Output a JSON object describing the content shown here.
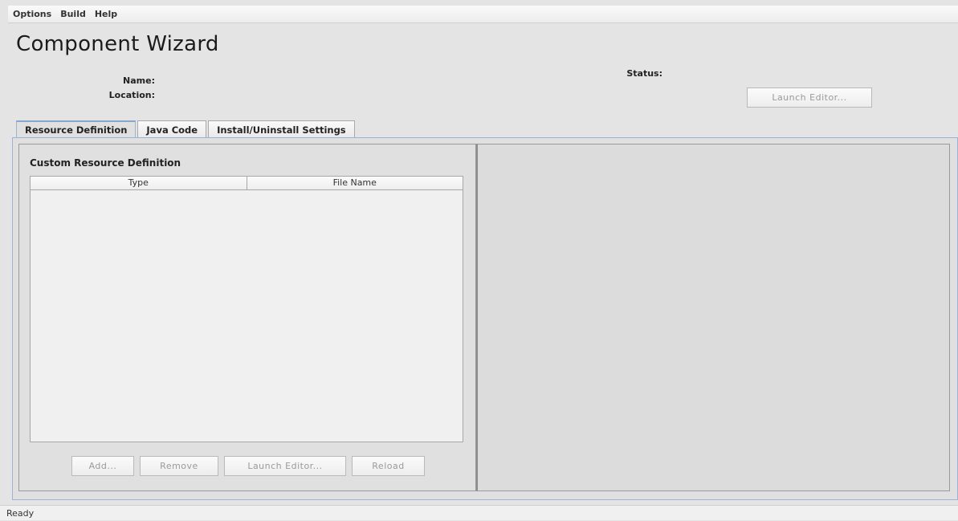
{
  "menu": [
    "Options",
    "Build",
    "Help"
  ],
  "title": "Component Wizard",
  "info": {
    "name_label": "Name:",
    "location_label": "Location:",
    "status_label": "Status:",
    "launch_editor_label": "Launch Editor..."
  },
  "tabs": [
    "Resource Definition",
    "Java Code",
    "Install/Uninstall Settings"
  ],
  "resource": {
    "section_title": "Custom Resource Definition",
    "columns": [
      "Type",
      "File Name"
    ],
    "buttons": {
      "add": "Add...",
      "remove": "Remove",
      "launch_editor": "Launch Editor...",
      "reload": "Reload"
    }
  },
  "status_bar": "Ready"
}
